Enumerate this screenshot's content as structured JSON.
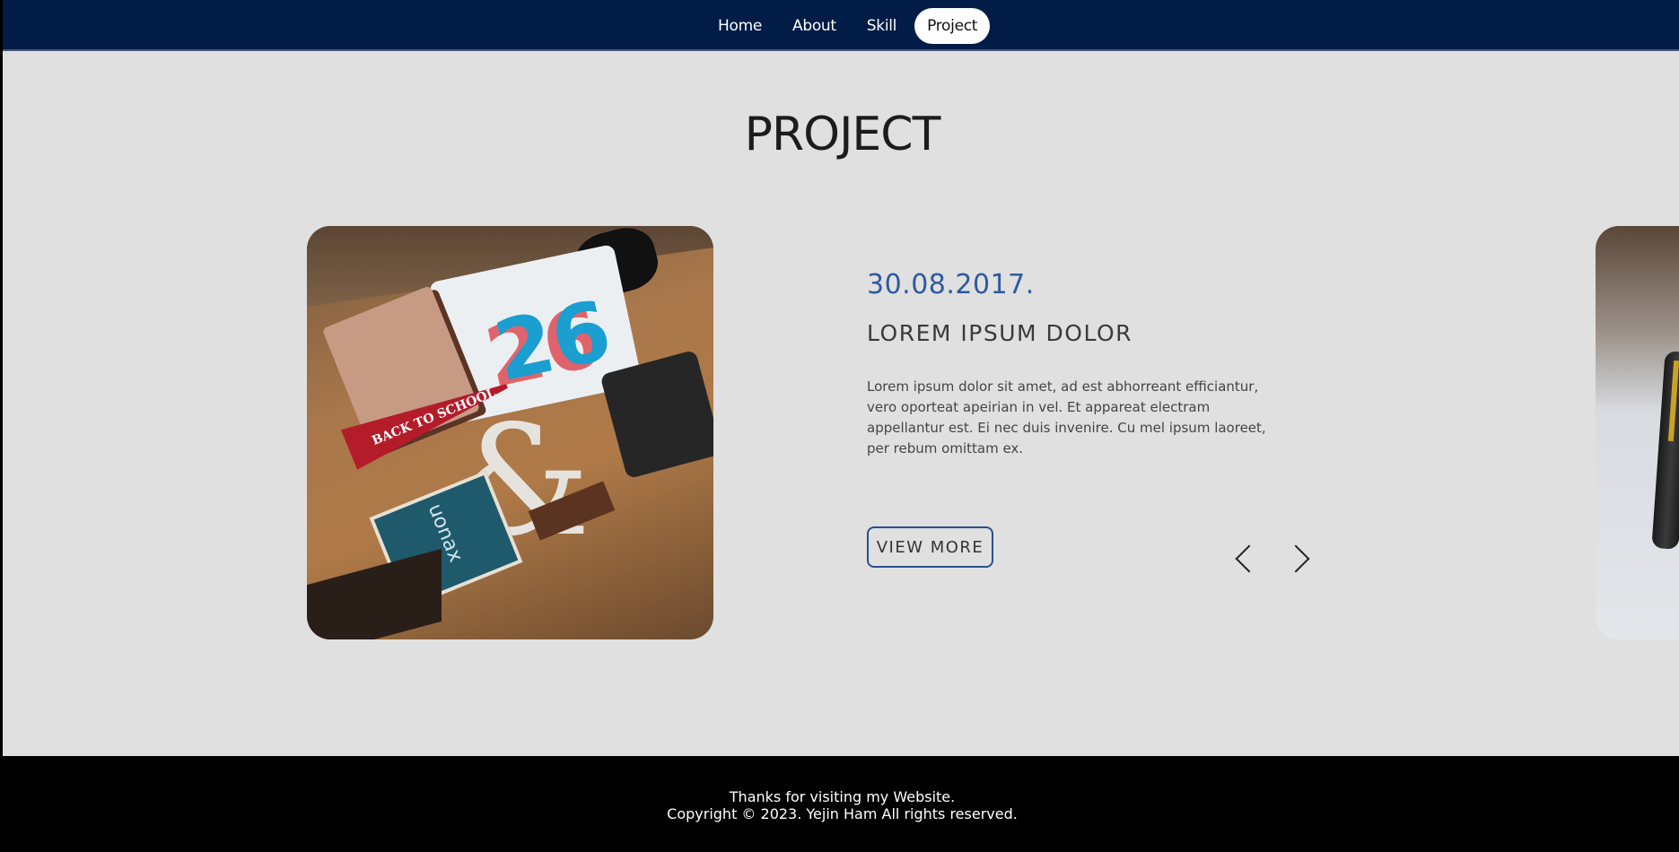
{
  "nav": {
    "items": [
      {
        "label": "Home"
      },
      {
        "label": "About"
      },
      {
        "label": "Skill"
      },
      {
        "label": "Project"
      }
    ],
    "active": "Project"
  },
  "section": {
    "title": "PROJECT"
  },
  "project": {
    "date": "30.08.2017.",
    "title": "LOREM IPSUM DOLOR",
    "description": "Lorem ipsum dolor sit amet, ad est abhorreant efficiantur, vero oporteat apeirian in vel. Et appareat electram appellantur est. Ei nec duis invenire. Cu mel ipsum laoreet, per rebum omittam ex.",
    "button_label": "VIEW MORE",
    "image_text": {
      "pennant": "BACK TO SCHOOL",
      "shirt_number": "26",
      "book_label": "uonax"
    }
  },
  "carousel": {
    "prev_icon": "chevron-left-icon",
    "next_icon": "chevron-right-icon"
  },
  "footer": {
    "line1": "Thanks for visiting my Website.",
    "line2": "Copyright © 2023. Yejin Ham All rights reserved."
  },
  "colors": {
    "nav_bg": "#001c47",
    "page_bg": "#e0e0e0",
    "accent": "#2e5aa0",
    "footer_bg": "#000000"
  }
}
